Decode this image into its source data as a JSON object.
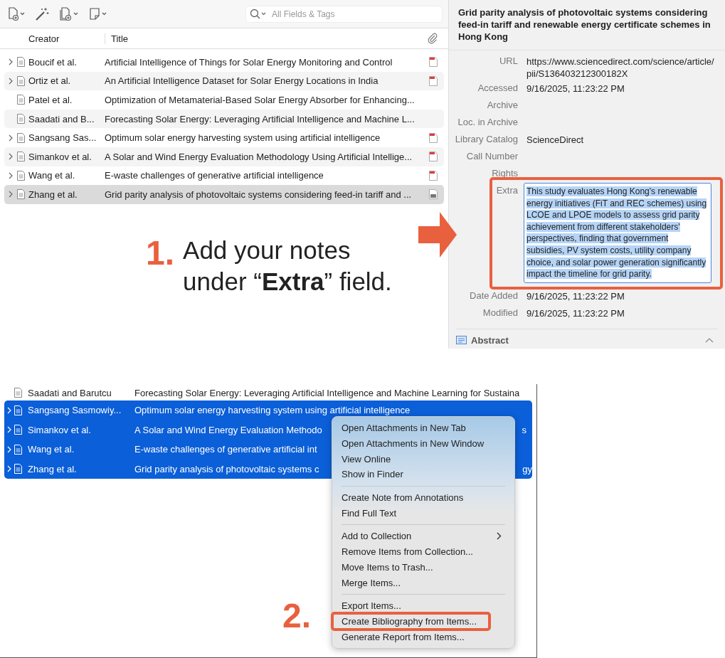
{
  "top_window": {
    "search": {
      "placeholder": "All Fields & Tags"
    },
    "columns": [
      "Creator",
      "Title"
    ],
    "rows": [
      {
        "creator": "Boucif et al.",
        "title": "Artificial Intelligence of Things for Solar Energy Monitoring and Control",
        "expandable": true,
        "attachment": {
          "kind": "pdf"
        },
        "selected": false
      },
      {
        "creator": "Ortiz et al.",
        "title": "An Artificial Intelligence Dataset for Solar Energy Locations in India",
        "expandable": true,
        "attachment": {
          "kind": "pdf"
        },
        "selected": false
      },
      {
        "creator": "Patel et al.",
        "title": "Optimization of Metamaterial-Based Solar Energy Absorber for Enhancing...",
        "expandable": false,
        "selected": false
      },
      {
        "creator": "Saadati and B...",
        "title": "Forecasting Solar Energy: Leveraging Artificial Intelligence and Machine L...",
        "expandable": false,
        "selected": false
      },
      {
        "creator": "Sangsang Sas...",
        "title": "Optimum solar energy harvesting system using artificial intelligence",
        "expandable": true,
        "attachment": {
          "kind": "pdf"
        },
        "selected": false
      },
      {
        "creator": "Simankov et al.",
        "title": "A Solar and Wind Energy Evaluation Methodology Using Artificial Intellige...",
        "expandable": true,
        "attachment": {
          "kind": "pdf"
        },
        "selected": false
      },
      {
        "creator": "Wang et al.",
        "title": "E-waste challenges of generative artificial intelligence",
        "expandable": true,
        "attachment": {
          "kind": "pdf"
        },
        "selected": false
      },
      {
        "creator": "Zhang et al.",
        "title": "Grid parity analysis of photovoltaic systems considering feed-in tariff and ...",
        "expandable": true,
        "attachment": {
          "kind": "snapshot"
        },
        "selected": true
      }
    ],
    "detail": {
      "title": "Grid parity analysis of photovoltaic systems considering feed-in tariff and renewable energy certificate schemes in Hong Kong",
      "fields": [
        {
          "label": "URL",
          "value": "https://www.sciencedirect.com/science/article/pii/S136403212300182X"
        },
        {
          "label": "Accessed",
          "value": "9/16/2025, 11:23:22 PM"
        },
        {
          "label": "Archive"
        },
        {
          "label": "Loc. in Archive"
        },
        {
          "label": "Library Catalog",
          "value": "ScienceDirect"
        },
        {
          "label": "Call Number"
        },
        {
          "label": "Rights"
        },
        {
          "label": "Extra",
          "value": "This study evaluates Hong Kong's renewable energy initiatives (FiT and REC schemes) using LCOE and LPOE models to assess grid parity achievement from different stakeholders' perspectives, finding that government subsidies, PV system costs, utility company choice, and solar power generation significantly impact the timeline for grid parity.",
          "editing": true,
          "callout": true
        },
        {
          "label": "Date Added",
          "value": "9/16/2025, 11:23:22 PM"
        },
        {
          "label": "Modified",
          "value": "9/16/2025, 11:23:22 PM"
        }
      ],
      "section": {
        "title": "Abstract",
        "expanded": true
      }
    }
  },
  "annotations": [
    {
      "number": "1.",
      "text": "Add your notes under “**Extra**” field."
    },
    {
      "number": "2."
    }
  ],
  "bottom_window": {
    "rows": [
      {
        "creator": "Saadati and Barutcu",
        "title": "Forecasting Solar Energy: Leveraging Artificial Intelligence and Machine Learning for Sustaina",
        "expandable": false,
        "selected": false
      },
      {
        "creator": "Sangsang Sasmowiy...",
        "title": "Optimum solar energy harvesting system using artificial intelligence",
        "expandable": true,
        "selected": true
      },
      {
        "creator": "Simankov et al.",
        "title": "A Solar and Wind Energy Evaluation Methodo",
        "title_tail": "s",
        "expandable": true,
        "selected": true
      },
      {
        "creator": "Wang et al.",
        "title": "E-waste challenges of generative artificial int",
        "expandable": true,
        "selected": true
      },
      {
        "creator": "Zhang et al.",
        "title": "Grid parity analysis of photovoltaic systems c",
        "title_tail": "gy",
        "expandable": true,
        "selected": true
      }
    ],
    "context_menu": {
      "groups": [
        [
          {
            "label": "Open Attachments in New Tab"
          },
          {
            "label": "Open Attachments in New Window"
          },
          {
            "label": "View Online"
          },
          {
            "label": "Show in Finder"
          }
        ],
        [
          {
            "label": "Create Note from Annotations"
          },
          {
            "label": "Find Full Text"
          }
        ],
        [
          {
            "label": "Add to Collection",
            "submenu": true
          },
          {
            "label": "Remove Items from Collection..."
          },
          {
            "label": "Move Items to Trash..."
          },
          {
            "label": "Merge Items..."
          }
        ],
        [
          {
            "label": "Export Items..."
          },
          {
            "label": "Create Bibliography from Items...",
            "callout": true
          },
          {
            "label": "Generate Report from Items..."
          }
        ]
      ]
    }
  }
}
